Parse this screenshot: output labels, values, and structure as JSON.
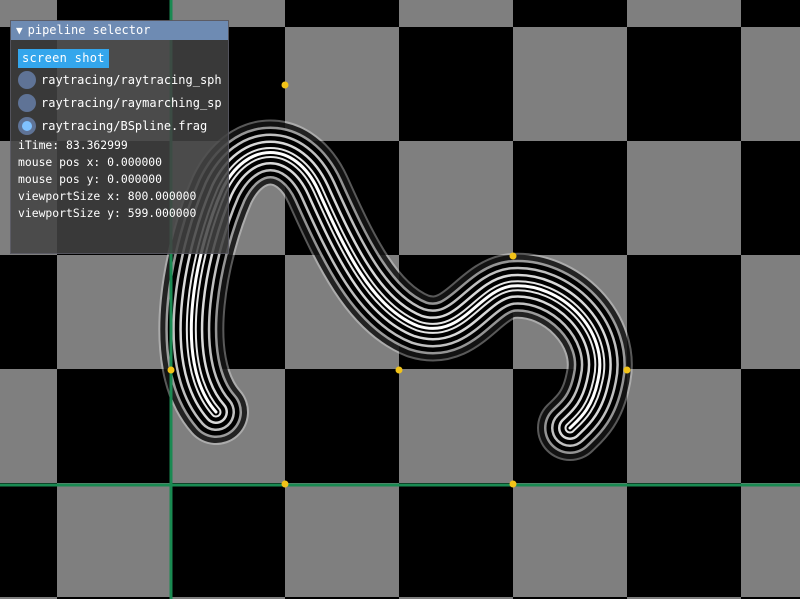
{
  "window": {
    "title": "pipeline selector",
    "collapse_icon": "triangle-down-icon",
    "button_label": "screen shot",
    "options": [
      {
        "label": "raytracing/raytracing_sphere.frag",
        "selected": false
      },
      {
        "label": "raytracing/raymarching_sphere.frag",
        "selected": false
      },
      {
        "label": "raytracing/BSpline.frag",
        "selected": true
      }
    ],
    "info": {
      "itime": "iTime: 83.362999",
      "mouse_x": "mouse pos x: 0.000000",
      "mouse_y": "mouse pos y: 0.000000",
      "viewport_x": "viewportSize x: 800.000000",
      "viewport_y": "viewportSize y: 599.000000"
    }
  },
  "colors": {
    "checker_light": "#7f7f7f",
    "checker_dark": "#000000",
    "axis": "#1a8a52",
    "control_point": "#f2c318",
    "curve": "#ffffff"
  }
}
